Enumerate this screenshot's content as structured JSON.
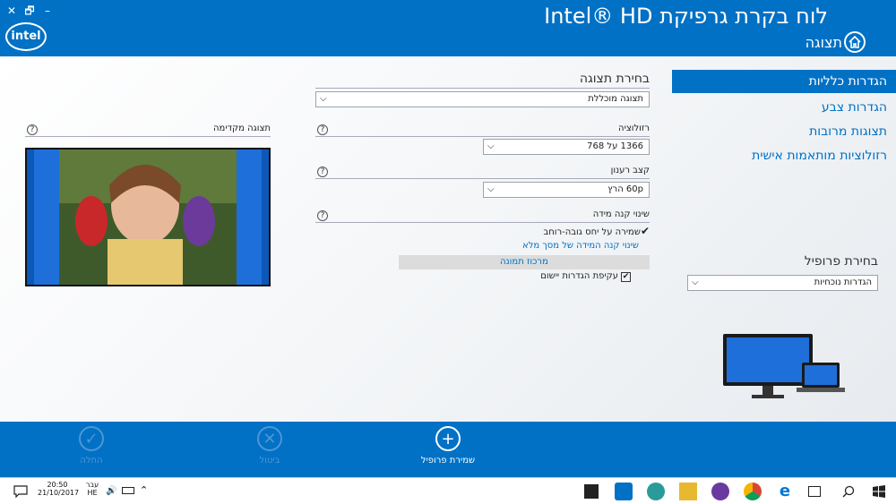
{
  "window": {
    "close": "✕",
    "restore": "🗗",
    "minimize": "–"
  },
  "header": {
    "logo": "intel",
    "title": "לוח בקרת גרפיקת Intel® HD",
    "page_title": "תצוגה"
  },
  "sidebar": {
    "items": [
      {
        "label": "הגדרות כלליות",
        "active": true
      },
      {
        "label": "הגדרות צבע",
        "active": false
      },
      {
        "label": "תצוגות מרובות",
        "active": false
      },
      {
        "label": "רזולוציות מותאמות אישית",
        "active": false
      }
    ],
    "profile_heading": "בחירת פרופיל",
    "profile_value": "הגדרות נוכחיות"
  },
  "display": {
    "heading": "בחירת תצוגה",
    "value": "תצוגה מוכללת"
  },
  "preview": {
    "label": "תצוגה מקדימה"
  },
  "resolution": {
    "label": "רזולוציה",
    "value": "1366 על 768"
  },
  "refresh": {
    "label": "קצב רענון",
    "value": "60p הרץ"
  },
  "scaling": {
    "label": "שינוי קנה מידה",
    "maintain_aspect": "שמירה על יחס גובה-רוחב",
    "maintain_aspect_checked": true,
    "full_screen": "שינוי קנה המידה של מסך מלא",
    "center_image": "מרכוז תמונה",
    "override_app": "עקיפת הגדרות יישום",
    "override_app_checked": true
  },
  "footer": {
    "apply": "החלה",
    "cancel": "ביטול",
    "save_profile": "שמירת פרופיל"
  },
  "taskbar": {
    "time": "20:50",
    "date": "21/10/2017",
    "lang_top": "עבר",
    "lang_bottom": "HE"
  },
  "colors": {
    "accent": "#0071c5",
    "disabled": "#4f95d6"
  }
}
